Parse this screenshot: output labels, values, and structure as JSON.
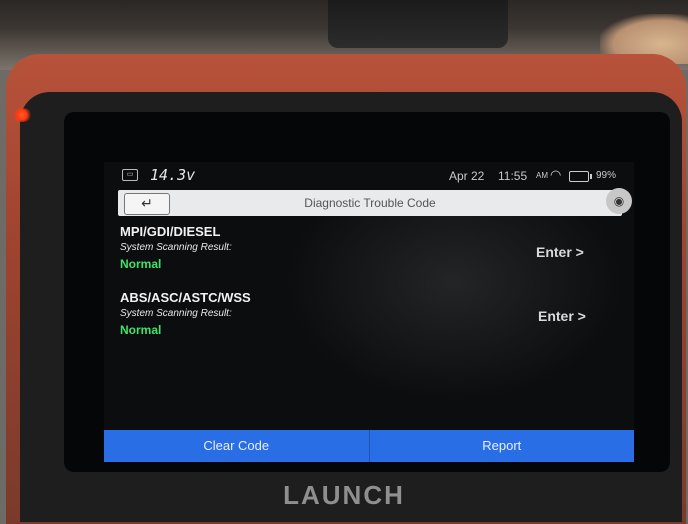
{
  "status_bar": {
    "voltage": "14.3v",
    "date": "Apr 22",
    "time": "11:55",
    "ampm": "AM",
    "battery": "99%",
    "icons": [
      "vehicle-status-icon",
      "wifi-icon",
      "battery-icon"
    ]
  },
  "title_bar": {
    "back_icon": "↵",
    "title": "Diagnostic Trouble Code",
    "camera_icon": "camera-icon"
  },
  "modules": [
    {
      "name": "MPI/GDI/DIESEL",
      "label": "System Scanning Result:",
      "result": "Normal",
      "action": "Enter >"
    },
    {
      "name": "ABS/ASC/ASTC/WSS",
      "label": "System Scanning Result:",
      "result": "Normal",
      "action": "Enter >"
    }
  ],
  "bottom_bar": {
    "clear_code": "Clear Code",
    "report": "Report"
  },
  "brand": "LAUNCH",
  "colors": {
    "accent_blue": "#2a6ee6",
    "result_green": "#3fe36a",
    "device_orange": "#b8523a"
  }
}
